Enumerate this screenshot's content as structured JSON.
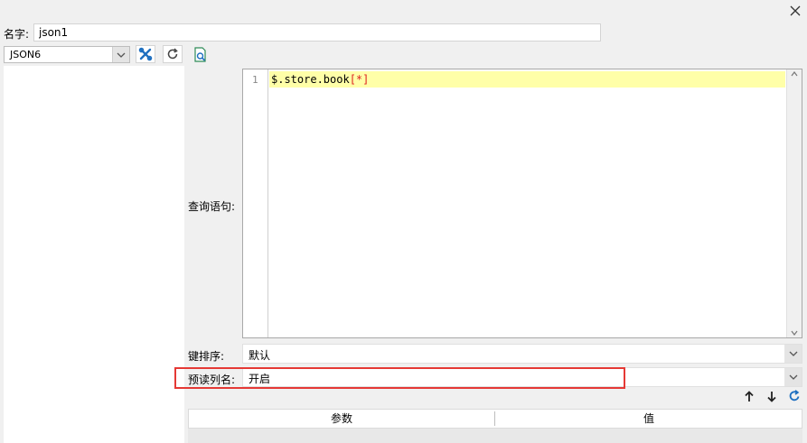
{
  "window": {
    "close_icon": "close-icon"
  },
  "name": {
    "label": "名字:",
    "value": "json1"
  },
  "connection": {
    "selected": "JSON6",
    "icons": [
      "chevron-down-icon",
      "wrench-icon",
      "refresh-icon",
      "preview-icon"
    ]
  },
  "query": {
    "label": "查询语句:",
    "line_number": "1",
    "code_prefix": "$.store.book",
    "code_bracket": "[*]"
  },
  "sort": {
    "label": "键排序:",
    "value": "默认"
  },
  "preread": {
    "label": "预读列名:",
    "value": "开启"
  },
  "params_table": {
    "columns": [
      "参数",
      "值"
    ],
    "row_icons": [
      "arrow-up-icon",
      "arrow-down-icon",
      "reload-icon"
    ]
  },
  "colors": {
    "highlight_border": "#e53935",
    "code_line_bg": "#ffffa8",
    "icon_blue": "#1e6fc0"
  }
}
